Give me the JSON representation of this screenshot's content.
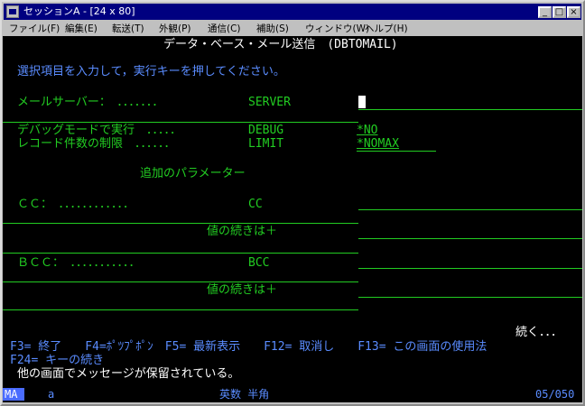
{
  "window": {
    "title": "セッションA - [24 x 80]"
  },
  "menu": [
    "ファイル(F)",
    "編集(E)",
    "転送(T)",
    "外観(P)",
    "通信(C)",
    "補助(S)",
    "ウィンドウ(W)",
    "ヘルプ(H)"
  ],
  "screen": {
    "heading": "データ・ベース・メール送信　(DBTOMAIL)",
    "instruction": "選択項目を入力して，実行キーを押してください。",
    "fields": [
      {
        "label": "メールサーバー：　．．．．．．．",
        "keyword": "SERVER",
        "value": ""
      },
      {
        "label": "デバッグモードで実行　．．．．．",
        "keyword": "DEBUG",
        "value": "*NO"
      },
      {
        "label": "レコード件数の制限　．．．．．．",
        "keyword": "LIMIT",
        "value": "*NOMAX"
      }
    ],
    "additional_params": "追加のパラメーター",
    "cc_label": "ＣＣ：　．．．．．．．．．．．．",
    "cc_keyword": "CC",
    "continue_label": "値の続きは＋",
    "bcc_label": "ＢＣＣ：　．．．．．．．．．．．",
    "bcc_keyword": "BCC",
    "more": "続く．．．",
    "fkeys_line1": "F3= 終了　　F4=ﾎﾟﾂﾌﾟﾎﾟﾝ　F5= 最新表示　　F12= 取消し　　F13= この画面の使用法",
    "fkeys_line2": "F24= キーの続き",
    "message": "他の画面でメッセージが保留されている。"
  },
  "status_bar": {
    "ma": "MA",
    "mode": "a",
    "input_mode": "英数 半角",
    "position": "05/050"
  },
  "colors": {
    "field_text": "#22cc22",
    "highlight": "#ffffff",
    "heading": "#ffffff",
    "status_accent": "#4a6cff"
  }
}
